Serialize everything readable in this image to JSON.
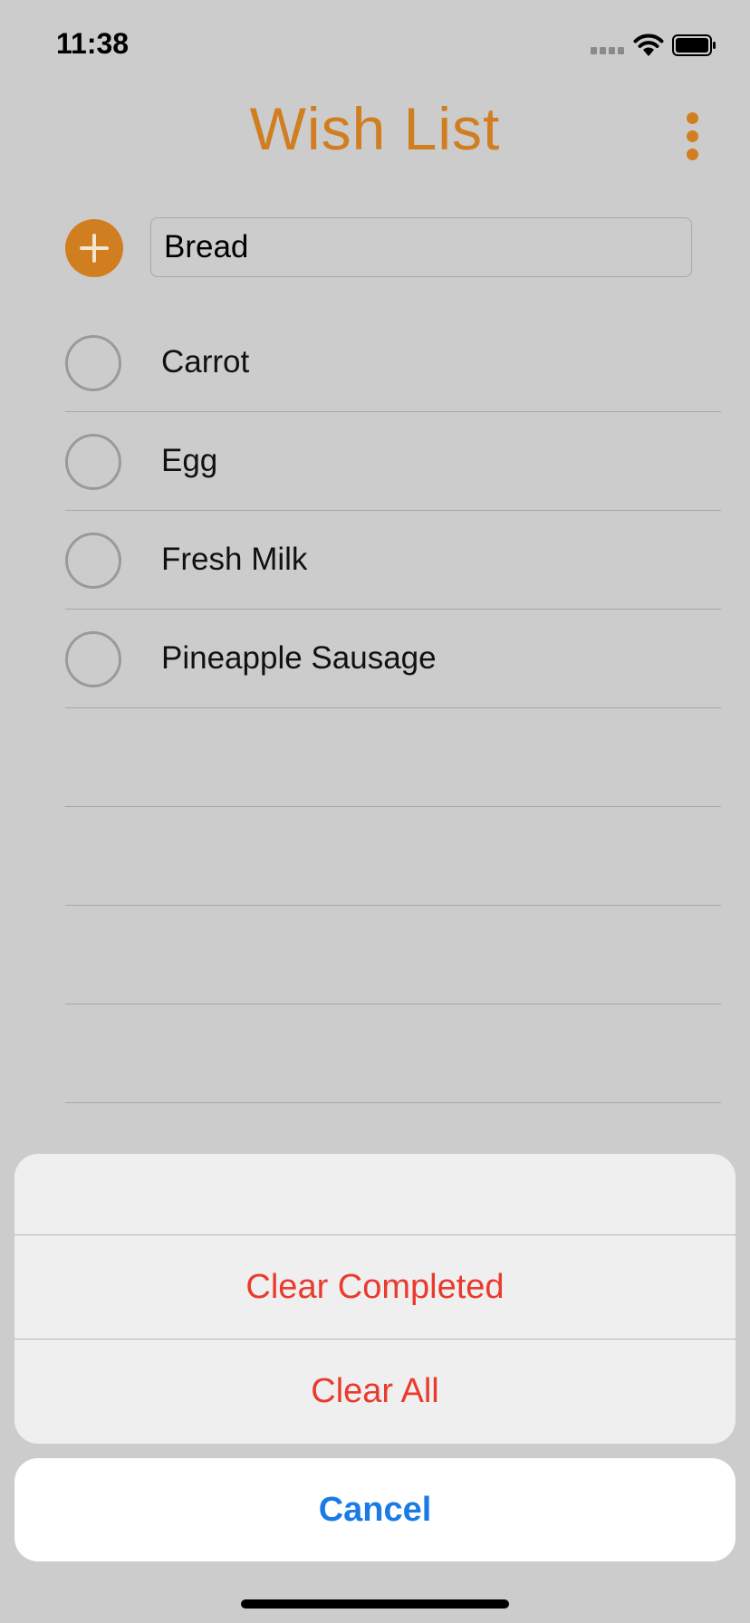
{
  "status_bar": {
    "time": "11:38",
    "icons": [
      "signal-icon",
      "wifi-icon",
      "battery-icon"
    ]
  },
  "header": {
    "title": "Wish List",
    "menu_icon": "more-vertical-icon"
  },
  "add_item": {
    "icon": "plus-icon",
    "input_value": "Bread"
  },
  "list": {
    "items": [
      {
        "label": "Carrot",
        "checked": false
      },
      {
        "label": "Egg",
        "checked": false
      },
      {
        "label": "Fresh Milk",
        "checked": false
      },
      {
        "label": "Pineapple Sausage",
        "checked": false
      }
    ]
  },
  "action_sheet": {
    "actions": [
      {
        "label": "Clear Completed"
      },
      {
        "label": "Clear All"
      }
    ],
    "cancel_label": "Cancel"
  },
  "colors": {
    "accent": "#d17e21",
    "destructive": "#ea3a2d",
    "cancel": "#1a7be6",
    "background": "#cccccc"
  }
}
